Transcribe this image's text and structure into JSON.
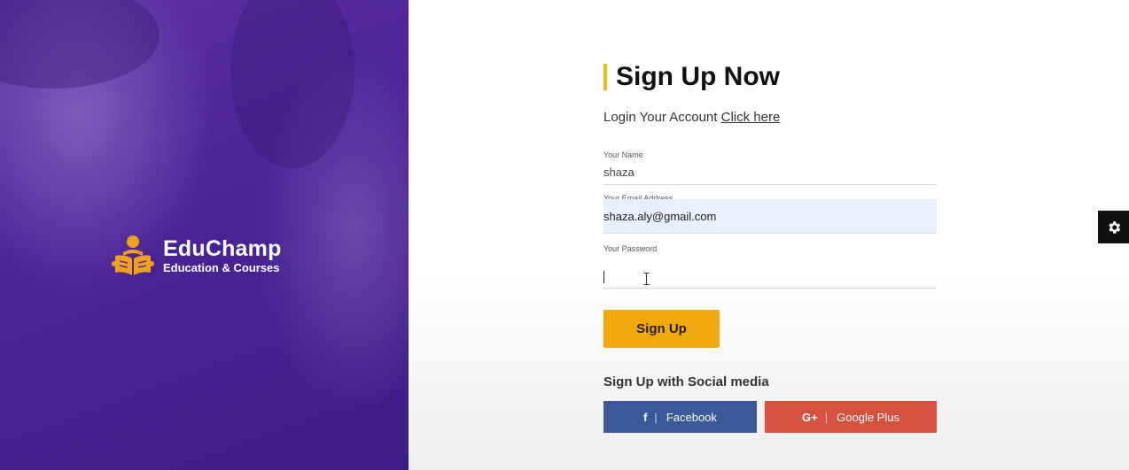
{
  "brand": {
    "name": "EduChamp",
    "tagline": "Education & Courses",
    "logo_icon": "reader-logo-icon",
    "logo_color": "#f0a11a"
  },
  "form": {
    "title_bold": "Sign Up",
    "title_rest": " Now",
    "login_prompt": "Login Your Account ",
    "login_link": "Click here",
    "fields": [
      {
        "label": "Your Name",
        "value": "shaza"
      },
      {
        "label": "Your Email Address",
        "value": "shaza.aly@gmail.com"
      },
      {
        "label": "Your Password",
        "value": ""
      }
    ],
    "submit_label": "Sign Up"
  },
  "social": {
    "title": "Sign Up with Social media",
    "facebook": {
      "icon_text": "f",
      "label": "Facebook",
      "color": "#3a5998"
    },
    "google": {
      "icon_text": "G+",
      "label": "Google Plus",
      "color": "#d5513d"
    }
  },
  "colors": {
    "accent": "#f2a90f",
    "left_panel": "#4b2397"
  },
  "settings": {
    "icon": "gear-icon"
  }
}
